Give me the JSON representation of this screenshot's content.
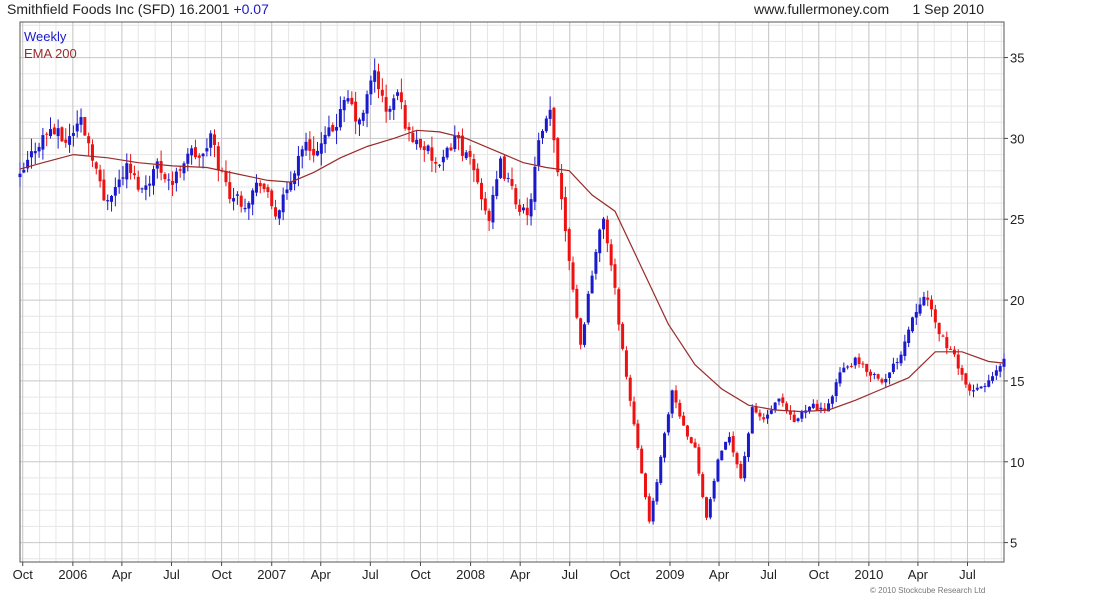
{
  "header": {
    "security": "Smithfield Foods Inc (SFD)",
    "last_price": "16.2001",
    "change": "+0.07",
    "website": "www.fullermoney.com",
    "date": "1 Sep 2010"
  },
  "copyright": "© 2010 Stockcube Research Ltd",
  "colors": {
    "up": "#1a1acc",
    "down": "#ee1111",
    "ema": "#9a2b2b",
    "grid_major": "#c8c8c8",
    "grid_minor": "#e6e6e6"
  },
  "chart_data": {
    "type": "candlestick",
    "title": "Smithfield Foods Inc (SFD)",
    "frequency": "weekly",
    "legend": [
      "Weekly",
      "EMA 200"
    ],
    "legend_placement": "top-left",
    "ylim": [
      3.8,
      37.2
    ],
    "y_ticks": [
      5,
      10,
      15,
      20,
      25,
      30,
      35
    ],
    "y_axis_side": "right",
    "grid": true,
    "x_range": [
      "2005-09-26",
      "2010-09-06"
    ],
    "x_ticks": [
      {
        "date": "2005-10-01",
        "label": "Oct"
      },
      {
        "date": "2006-01-01",
        "label": "2006"
      },
      {
        "date": "2006-04-01",
        "label": "Apr"
      },
      {
        "date": "2006-07-01",
        "label": "Jul"
      },
      {
        "date": "2006-10-01",
        "label": "Oct"
      },
      {
        "date": "2007-01-01",
        "label": "2007"
      },
      {
        "date": "2007-04-01",
        "label": "Apr"
      },
      {
        "date": "2007-07-01",
        "label": "Jul"
      },
      {
        "date": "2007-10-01",
        "label": "Oct"
      },
      {
        "date": "2008-01-01",
        "label": "2008"
      },
      {
        "date": "2008-04-01",
        "label": "Apr"
      },
      {
        "date": "2008-07-01",
        "label": "Jul"
      },
      {
        "date": "2008-10-01",
        "label": "Oct"
      },
      {
        "date": "2009-01-01",
        "label": "2009"
      },
      {
        "date": "2009-04-01",
        "label": "Apr"
      },
      {
        "date": "2009-07-01",
        "label": "Jul"
      },
      {
        "date": "2009-10-01",
        "label": "Oct"
      },
      {
        "date": "2010-01-01",
        "label": "2010"
      },
      {
        "date": "2010-04-01",
        "label": "Apr"
      },
      {
        "date": "2010-07-01",
        "label": "Jul"
      }
    ],
    "close_path": [
      [
        "2005-09-26",
        27.5
      ],
      [
        "2005-10-24",
        29.5
      ],
      [
        "2005-11-21",
        30.6
      ],
      [
        "2005-12-19",
        29.8
      ],
      [
        "2006-01-16",
        31.2
      ],
      [
        "2006-02-06",
        29.0
      ],
      [
        "2006-02-27",
        26.2
      ],
      [
        "2006-03-20",
        27.0
      ],
      [
        "2006-04-10",
        28.2
      ],
      [
        "2006-05-08",
        26.8
      ],
      [
        "2006-06-05",
        28.4
      ],
      [
        "2006-07-03",
        27.2
      ],
      [
        "2006-07-31",
        29.2
      ],
      [
        "2006-08-28",
        28.8
      ],
      [
        "2006-09-11",
        30.2
      ],
      [
        "2006-09-25",
        28.4
      ],
      [
        "2006-10-16",
        26.6
      ],
      [
        "2006-11-13",
        26.0
      ],
      [
        "2006-12-11",
        27.4
      ],
      [
        "2007-01-08",
        25.3
      ],
      [
        "2007-01-29",
        26.6
      ],
      [
        "2007-02-26",
        29.6
      ],
      [
        "2007-03-26",
        29.2
      ],
      [
        "2007-04-23",
        30.6
      ],
      [
        "2007-05-21",
        32.4
      ],
      [
        "2007-06-11",
        30.8
      ],
      [
        "2007-07-09",
        34.2
      ],
      [
        "2007-07-30",
        31.5
      ],
      [
        "2007-08-20",
        32.8
      ],
      [
        "2007-09-10",
        30.2
      ],
      [
        "2007-10-08",
        29.5
      ],
      [
        "2007-11-05",
        28.0
      ],
      [
        "2007-12-03",
        30.2
      ],
      [
        "2008-01-07",
        28.0
      ],
      [
        "2008-02-04",
        25.0
      ],
      [
        "2008-02-25",
        28.4
      ],
      [
        "2008-03-24",
        26.2
      ],
      [
        "2008-04-14",
        25.0
      ],
      [
        "2008-05-05",
        29.6
      ],
      [
        "2008-05-26",
        31.5
      ],
      [
        "2008-06-09",
        28.2
      ],
      [
        "2008-07-07",
        20.8
      ],
      [
        "2008-07-21",
        17.2
      ],
      [
        "2008-08-11",
        21.8
      ],
      [
        "2008-09-01",
        25.2
      ],
      [
        "2008-09-22",
        20.5
      ],
      [
        "2008-10-13",
        15.2
      ],
      [
        "2008-11-03",
        11.0
      ],
      [
        "2008-11-24",
        6.2
      ],
      [
        "2008-12-15",
        10.2
      ],
      [
        "2009-01-05",
        14.4
      ],
      [
        "2009-01-26",
        12.2
      ],
      [
        "2009-02-16",
        10.8
      ],
      [
        "2009-03-09",
        6.5
      ],
      [
        "2009-03-30",
        10.0
      ],
      [
        "2009-04-20",
        11.6
      ],
      [
        "2009-05-11",
        9.0
      ],
      [
        "2009-06-01",
        13.2
      ],
      [
        "2009-06-22",
        12.6
      ],
      [
        "2009-07-20",
        13.8
      ],
      [
        "2009-08-17",
        12.4
      ],
      [
        "2009-09-14",
        13.6
      ],
      [
        "2009-10-12",
        13.0
      ],
      [
        "2009-11-09",
        15.5
      ],
      [
        "2009-12-07",
        16.2
      ],
      [
        "2010-01-04",
        15.5
      ],
      [
        "2010-02-01",
        15.0
      ],
      [
        "2010-03-01",
        16.8
      ],
      [
        "2010-03-22",
        19.0
      ],
      [
        "2010-04-12",
        20.5
      ],
      [
        "2010-05-03",
        18.5
      ],
      [
        "2010-05-24",
        17.2
      ],
      [
        "2010-06-14",
        16.0
      ],
      [
        "2010-07-05",
        14.2
      ],
      [
        "2010-07-26",
        14.6
      ],
      [
        "2010-08-16",
        15.2
      ],
      [
        "2010-09-06",
        16.2
      ]
    ],
    "ema_200": [
      [
        "2005-09-26",
        28.1
      ],
      [
        "2005-11-07",
        28.5
      ],
      [
        "2006-01-02",
        29.0
      ],
      [
        "2006-03-06",
        28.8
      ],
      [
        "2006-05-01",
        28.5
      ],
      [
        "2006-07-03",
        28.3
      ],
      [
        "2006-09-04",
        28.2
      ],
      [
        "2006-10-30",
        27.8
      ],
      [
        "2006-12-25",
        27.4
      ],
      [
        "2007-02-05",
        27.3
      ],
      [
        "2007-03-19",
        27.9
      ],
      [
        "2007-05-07",
        28.8
      ],
      [
        "2007-06-25",
        29.5
      ],
      [
        "2007-08-13",
        30.0
      ],
      [
        "2007-09-24",
        30.5
      ],
      [
        "2007-11-05",
        30.4
      ],
      [
        "2007-12-24",
        30.0
      ],
      [
        "2008-02-18",
        29.2
      ],
      [
        "2008-04-07",
        28.5
      ],
      [
        "2008-05-19",
        28.2
      ],
      [
        "2008-06-30",
        28.0
      ],
      [
        "2008-08-11",
        26.5
      ],
      [
        "2008-09-22",
        25.5
      ],
      [
        "2008-11-03",
        22.5
      ],
      [
        "2008-12-29",
        18.5
      ],
      [
        "2009-02-16",
        16.0
      ],
      [
        "2009-04-06",
        14.5
      ],
      [
        "2009-05-25",
        13.5
      ],
      [
        "2009-07-13",
        13.2
      ],
      [
        "2009-08-31",
        13.1
      ],
      [
        "2009-10-19",
        13.2
      ],
      [
        "2009-12-07",
        13.8
      ],
      [
        "2010-01-25",
        14.5
      ],
      [
        "2010-03-15",
        15.2
      ],
      [
        "2010-05-03",
        16.8
      ],
      [
        "2010-06-21",
        16.8
      ],
      [
        "2010-08-09",
        16.2
      ],
      [
        "2010-09-06",
        16.1
      ]
    ]
  }
}
